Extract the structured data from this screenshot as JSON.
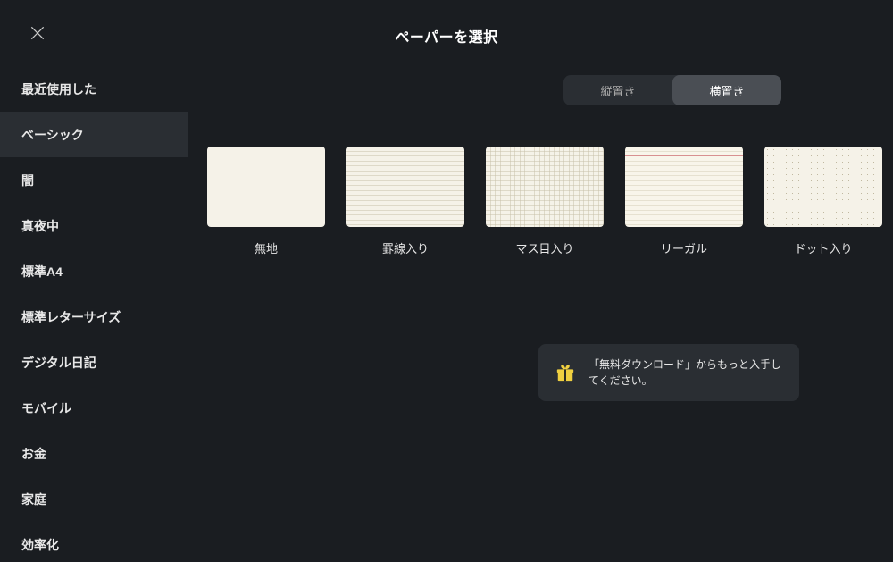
{
  "header": {
    "title": "ペーパーを選択"
  },
  "sidebar": {
    "items": [
      {
        "label": "最近使用した",
        "active": false
      },
      {
        "label": "ベーシック",
        "active": true
      },
      {
        "label": "闇",
        "active": false
      },
      {
        "label": "真夜中",
        "active": false
      },
      {
        "label": "標準A4",
        "active": false
      },
      {
        "label": "標準レターサイズ",
        "active": false
      },
      {
        "label": "デジタル日記",
        "active": false
      },
      {
        "label": "モバイル",
        "active": false
      },
      {
        "label": "お金",
        "active": false
      },
      {
        "label": "家庭",
        "active": false
      },
      {
        "label": "効率化",
        "active": false
      }
    ]
  },
  "orientation": {
    "portrait": "縦置き",
    "landscape": "横置き",
    "active": "landscape"
  },
  "templates": [
    {
      "label": "無地",
      "type": "blank"
    },
    {
      "label": "罫線入り",
      "type": "lined"
    },
    {
      "label": "マス目入り",
      "type": "grid"
    },
    {
      "label": "リーガル",
      "type": "legal"
    },
    {
      "label": "ドット入り",
      "type": "dot"
    }
  ],
  "download": {
    "text": "「無料ダウンロード」からもっと入手してください。"
  }
}
